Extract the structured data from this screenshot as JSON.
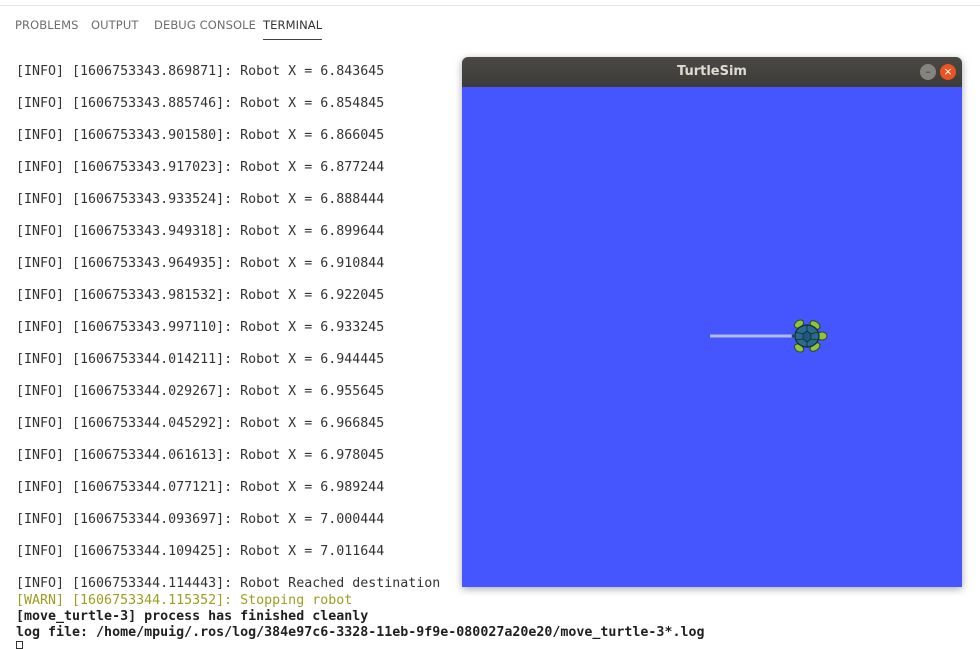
{
  "tabs": [
    {
      "label": "PROBLEMS"
    },
    {
      "label": "OUTPUT"
    },
    {
      "label": "DEBUG CONSOLE"
    },
    {
      "label": "TERMINAL",
      "active": true
    }
  ],
  "terminal": {
    "lines": [
      "[INFO] [1606753343.869871]: Robot X = 6.843645",
      "[INFO] [1606753343.885746]: Robot X = 6.854845",
      "[INFO] [1606753343.901580]: Robot X = 6.866045",
      "[INFO] [1606753343.917023]: Robot X = 6.877244",
      "[INFO] [1606753343.933524]: Robot X = 6.888444",
      "[INFO] [1606753343.949318]: Robot X = 6.899644",
      "[INFO] [1606753343.964935]: Robot X = 6.910844",
      "[INFO] [1606753343.981532]: Robot X = 6.922045",
      "[INFO] [1606753343.997110]: Robot X = 6.933245",
      "[INFO] [1606753344.014211]: Robot X = 6.944445",
      "[INFO] [1606753344.029267]: Robot X = 6.955645",
      "[INFO] [1606753344.045292]: Robot X = 6.966845",
      "[INFO] [1606753344.061613]: Robot X = 6.978045",
      "[INFO] [1606753344.077121]: Robot X = 6.989244",
      "[INFO] [1606753344.093697]: Robot X = 7.000444",
      "[INFO] [1606753344.109425]: Robot X = 7.011644",
      "[INFO] [1606753344.114443]: Robot Reached destination"
    ],
    "warn_line": "[WARN] [1606753344.115352]: Stopping robot",
    "finish_line": "[move_turtle-3] process has finished cleanly",
    "log_line": "log file: /home/mpuig/.ros/log/384e97c6-3328-11eb-9f9e-080027a20e20/move_turtle-3*.log"
  },
  "turtlesim": {
    "title": "TurtleSim",
    "minimize_glyph": "–",
    "close_glyph": "×",
    "background_color": "#4556ff",
    "trail_color": "#b3b8ff"
  }
}
